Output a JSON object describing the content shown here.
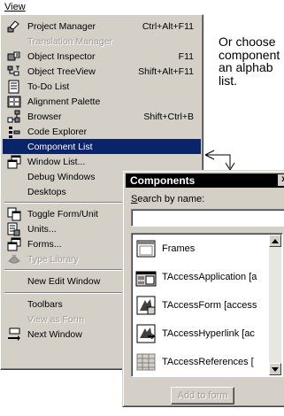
{
  "menubar": {
    "title": "View"
  },
  "menu": {
    "items": [
      {
        "label": "Project Manager",
        "shortcut": "Ctrl+Alt+F11",
        "icon": "project-manager-icon",
        "state": "normal"
      },
      {
        "label": "Translation Manager",
        "shortcut": "",
        "icon": "",
        "state": "disabled"
      },
      {
        "label": "Object Inspector",
        "shortcut": "F11",
        "icon": "object-inspector-icon",
        "state": "normal"
      },
      {
        "label": "Object TreeView",
        "shortcut": "Shift+Alt+F11",
        "icon": "object-treeview-icon",
        "state": "normal"
      },
      {
        "label": "To-Do List",
        "shortcut": "",
        "icon": "todo-list-icon",
        "state": "normal"
      },
      {
        "label": "Alignment Palette",
        "shortcut": "",
        "icon": "alignment-palette-icon",
        "state": "normal"
      },
      {
        "label": "Browser",
        "shortcut": "Shift+Ctrl+B",
        "icon": "browser-icon",
        "state": "normal"
      },
      {
        "label": "Code Explorer",
        "shortcut": "",
        "icon": "code-explorer-icon",
        "state": "normal"
      },
      {
        "label": "Component List",
        "shortcut": "",
        "icon": "",
        "state": "selected"
      },
      {
        "label": "Window List...",
        "shortcut": "",
        "icon": "window-list-icon",
        "state": "normal"
      },
      {
        "label": "Debug Windows",
        "shortcut": "",
        "icon": "",
        "state": "normal"
      },
      {
        "label": "Desktops",
        "shortcut": "",
        "icon": "",
        "state": "normal"
      },
      {
        "label": "Toggle Form/Unit",
        "shortcut": "",
        "icon": "toggle-form-unit-icon",
        "state": "normal"
      },
      {
        "label": "Units...",
        "shortcut": "",
        "icon": "units-icon",
        "state": "normal"
      },
      {
        "label": "Forms...",
        "shortcut": "",
        "icon": "forms-icon",
        "state": "normal"
      },
      {
        "label": "Type Library",
        "shortcut": "",
        "icon": "type-library-icon",
        "state": "disabled"
      },
      {
        "label": "New Edit Window",
        "shortcut": "",
        "icon": "",
        "state": "normal"
      },
      {
        "label": "Toolbars",
        "shortcut": "",
        "icon": "",
        "state": "normal"
      },
      {
        "label": "View as Form",
        "shortcut": "",
        "icon": "",
        "state": "disabled"
      },
      {
        "label": "Next Window",
        "shortcut": "",
        "icon": "next-window-icon",
        "state": "normal"
      }
    ]
  },
  "description": {
    "lines": [
      "Or choose",
      "component",
      "an alphab",
      "list."
    ]
  },
  "components_window": {
    "title": "Components",
    "close_label": "x",
    "search_label_accel": "S",
    "search_label_rest": "earch by name:",
    "search_value": "",
    "items": [
      {
        "label": "Frames",
        "icon": "frames-icon"
      },
      {
        "label": "TAccessApplication [a",
        "icon": "access-application-icon"
      },
      {
        "label": "TAccessForm [access",
        "icon": "access-form-icon"
      },
      {
        "label": "TAccessHyperlink [ac",
        "icon": "access-hyperlink-icon"
      },
      {
        "label": "TAccessReferences [",
        "icon": "access-references-icon"
      }
    ],
    "add_button_label": "Add to form"
  }
}
